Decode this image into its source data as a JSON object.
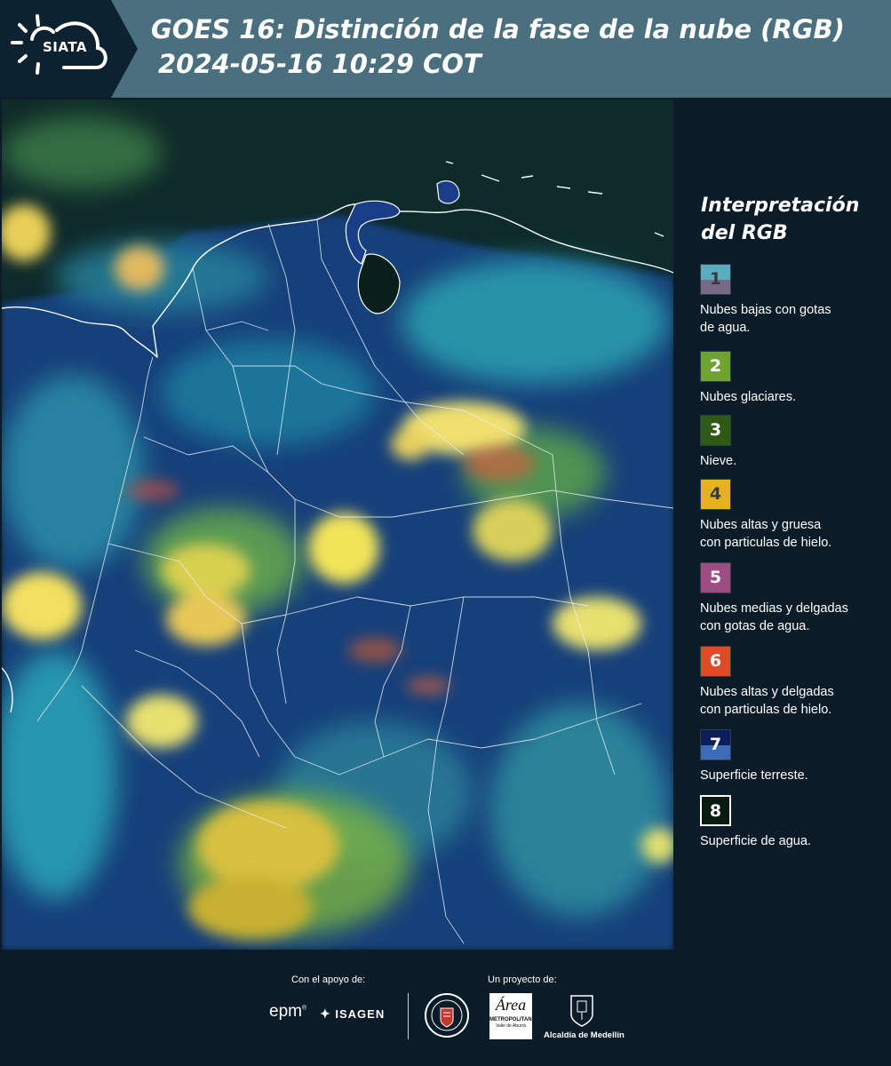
{
  "header": {
    "logo_text": "SIATA",
    "title_line1": "GOES 16: Distinción de la fase de la nube (RGB)",
    "title_line2": "2024-05-16 10:29 COT"
  },
  "legend": {
    "title_line1": "Interpretación",
    "title_line2": "del RGB",
    "items": [
      {
        "num": "1",
        "label_1": "Nubes bajas con gotas",
        "label_2": "de agua.",
        "color_top": "#5aacbf",
        "color_bottom": "#786a86"
      },
      {
        "num": "2",
        "label_1": "Nubes glaciares.",
        "label_2": "",
        "color_top": "#6ea334",
        "color_bottom": "#6ea334"
      },
      {
        "num": "3",
        "label_1": "Nieve.",
        "label_2": "",
        "color_top": "#2e5a16",
        "color_bottom": "#2e5a16"
      },
      {
        "num": "4",
        "label_1": "Nubes altas y gruesa",
        "label_2": "con particulas de hielo.",
        "color_top": "#e6b21f",
        "color_bottom": "#e6b21f"
      },
      {
        "num": "5",
        "label_1": "Nubes medias y delgadas",
        "label_2": "con gotas de agua.",
        "color_top": "#9e4d84",
        "color_bottom": "#9e4d84"
      },
      {
        "num": "6",
        "label_1": "Nubes altas y delgadas",
        "label_2": "con particulas de hielo.",
        "color_top": "#e04a26",
        "color_bottom": "#e04a26"
      },
      {
        "num": "7",
        "label_1": "Superficie terreste.",
        "label_2": "",
        "color_top": "#0d1d5c",
        "color_bottom": "#3e6ab8"
      },
      {
        "num": "8",
        "label_1": "Superficie de agua.",
        "label_2": "",
        "color_top": "#081a12",
        "color_bottom": "#081a12"
      }
    ]
  },
  "footer": {
    "support_label": "Con el apoyo de:",
    "project_label": "Un proyecto de:",
    "epm": "epm",
    "isagen": "ISAGEN",
    "area_line1": "Área",
    "area_line2": "METROPOLITANA",
    "area_line3": "Valle de Aburrá",
    "alcaldia": "Alcaldía de Medellín"
  }
}
